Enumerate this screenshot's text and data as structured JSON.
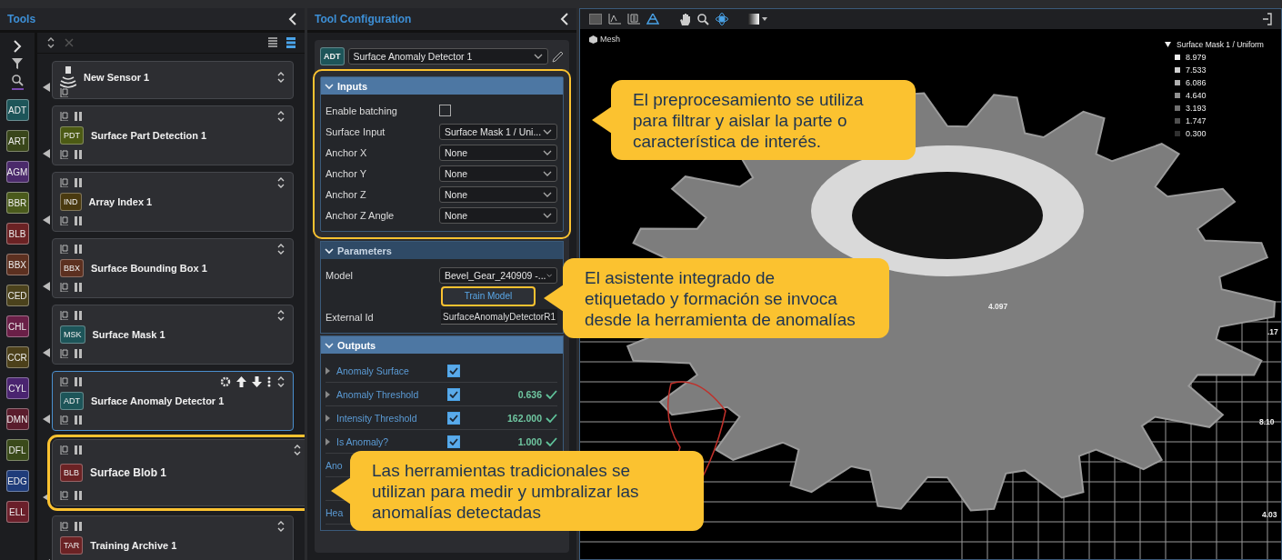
{
  "tools_panel": {
    "title": "Tools",
    "palette": [
      {
        "label": "ADT",
        "color": "#1d5559"
      },
      {
        "label": "ART",
        "color": "#39461a"
      },
      {
        "label": "AGM",
        "color": "#4b2a6b"
      },
      {
        "label": "BBR",
        "color": "#4a5a1c"
      },
      {
        "label": "BLB",
        "color": "#6b2224"
      },
      {
        "label": "BBX",
        "color": "#5c3020"
      },
      {
        "label": "CED",
        "color": "#4b421c"
      },
      {
        "label": "CHL",
        "color": "#6a1f47"
      },
      {
        "label": "CCR",
        "color": "#4c401a"
      },
      {
        "label": "CYL",
        "color": "#4a2470"
      },
      {
        "label": "DMN",
        "color": "#5a1c2c"
      },
      {
        "label": "DFL",
        "color": "#3a4a1a"
      },
      {
        "label": "EDG",
        "color": "#1f3c7a"
      },
      {
        "label": "ELL",
        "color": "#6a1f2a"
      }
    ],
    "tools": [
      {
        "kind": "sensor",
        "name": "New Sensor 1",
        "selected": false,
        "highlighted": false
      },
      {
        "kind": "tool",
        "badge": "PDT",
        "name": "Surface Part Detection 1",
        "color": "#4c5a14",
        "selected": false,
        "highlighted": false
      },
      {
        "kind": "tool",
        "badge": "IND",
        "name": "Array Index 1",
        "color": "#4a3a10",
        "selected": false,
        "highlighted": false
      },
      {
        "kind": "tool",
        "badge": "BBX",
        "name": "Surface Bounding Box 1",
        "color": "#5c3020",
        "selected": false,
        "highlighted": false
      },
      {
        "kind": "tool",
        "badge": "MSK",
        "name": "Surface Mask 1",
        "color": "#1d5559",
        "selected": false,
        "highlighted": false
      },
      {
        "kind": "tool",
        "badge": "ADT",
        "name": "Surface Anomaly Detector 1",
        "color": "#1d5559",
        "selected": true,
        "highlighted": false
      },
      {
        "kind": "tool",
        "badge": "BLB",
        "name": "Surface Blob 1",
        "color": "#6b2224",
        "selected": false,
        "highlighted": true
      },
      {
        "kind": "tool",
        "badge": "TAR",
        "name": "Training Archive 1",
        "color": "#6b2224",
        "selected": false,
        "highlighted": false
      }
    ]
  },
  "config_panel": {
    "title": "Tool Configuration",
    "tool": {
      "badge": "ADT",
      "name": "Surface Anomaly Detector 1"
    },
    "sections": [
      {
        "title": "Inputs",
        "expanded": true,
        "active": true,
        "highlighted": true,
        "rows": [
          {
            "kind": "checkbox",
            "label": "Enable batching",
            "checked": false
          },
          {
            "kind": "dropdown",
            "label": "Surface Input",
            "value": "Surface Mask 1 / Uni..."
          },
          {
            "kind": "dropdown",
            "label": "Anchor X",
            "value": "None"
          },
          {
            "kind": "dropdown",
            "label": "Anchor Y",
            "value": "None"
          },
          {
            "kind": "dropdown",
            "label": "Anchor Z",
            "value": "None"
          },
          {
            "kind": "dropdown",
            "label": "Anchor Z Angle",
            "value": "None"
          }
        ]
      },
      {
        "title": "Parameters",
        "expanded": true,
        "active": false,
        "highlighted": false,
        "rows": [
          {
            "kind": "dropdown",
            "label": "Model",
            "value": "Bevel_Gear_240909 -..."
          },
          {
            "kind": "button",
            "value": "Train Model",
            "highlighted": true
          },
          {
            "kind": "text",
            "label": "External Id",
            "value": "SurfaceAnomalyDetectorR1"
          }
        ]
      },
      {
        "title": "Outputs",
        "expanded": true,
        "active": true,
        "highlighted": false,
        "rows": [
          {
            "kind": "output",
            "label": "Anomaly Surface",
            "checked": true
          },
          {
            "kind": "output",
            "label": "Anomaly Threshold",
            "checked": true,
            "value": "0.636"
          },
          {
            "kind": "output",
            "label": "Intensity Threshold",
            "checked": true,
            "value": "162.000"
          },
          {
            "kind": "output",
            "label": "Is Anomaly?",
            "checked": true,
            "value": "1.000"
          },
          {
            "kind": "partial",
            "label": "Ano"
          },
          {
            "kind": "partial",
            "label": ""
          },
          {
            "kind": "partial",
            "label": "Hea"
          }
        ]
      }
    ]
  },
  "viewer": {
    "mesh_label": "Mesh",
    "legend": {
      "title": "Surface Mask 1 / Uniform",
      "entries": [
        {
          "value": "8.979",
          "color": "#f0f0f0"
        },
        {
          "value": "7.533",
          "color": "#d0d0d0"
        },
        {
          "value": "6.086",
          "color": "#b0b0b0"
        },
        {
          "value": "4.640",
          "color": "#909090"
        },
        {
          "value": "3.193",
          "color": "#707070"
        },
        {
          "value": "1.747",
          "color": "#505050"
        },
        {
          "value": "0.300",
          "color": "#303030"
        }
      ]
    },
    "axis_labels": [
      "4.097",
      ".17",
      "8.10",
      "4.03"
    ]
  },
  "callouts": [
    {
      "text": "El preprocesamiento se utiliza para filtrar y aislar la parte o característica de interés."
    },
    {
      "text": "El asistente integrado de etiquetado y formación se invoca desde la herramienta de anomalías"
    },
    {
      "text": "Las herramientas tradicionales se utilizan para medir y umbralizar las anomalías detectadas"
    }
  ]
}
